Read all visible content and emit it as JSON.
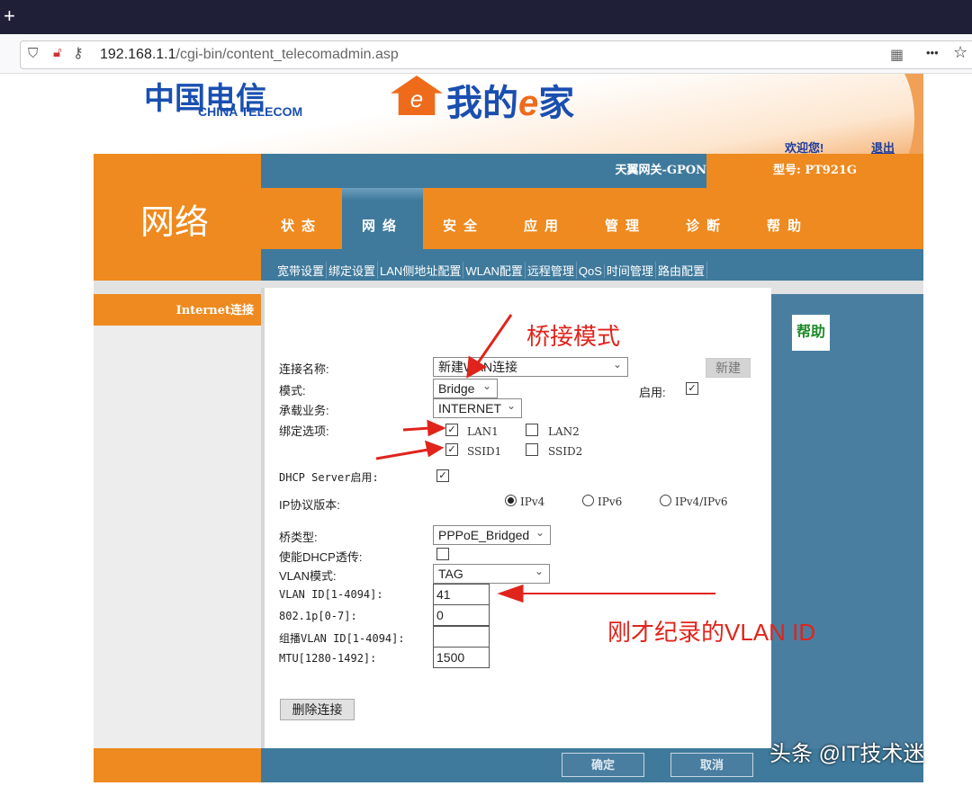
{
  "browser": {
    "new_tab": "+",
    "url_host": "192.168.1.1",
    "url_path": "/cgi-bin/content_telecomadmin.asp",
    "menu": "•••"
  },
  "header": {
    "logo_cn": "中国电信",
    "logo_en": "CHINA TELECOM",
    "brand_house": "e",
    "brand": "我的",
    "brand_e": "e",
    "brand_tail": "家",
    "welcome": "欢迎您!",
    "logout": "退出",
    "gateway": "天翼网关-GPON",
    "model": "型号: PT921G",
    "section": "网络"
  },
  "nav": [
    "状态",
    "网络",
    "安全",
    "应用",
    "管理",
    "诊断",
    "帮助"
  ],
  "subnav": [
    "宽带设置",
    "绑定设置",
    "LAN侧地址配置",
    "WLAN配置",
    "远程管理",
    "QoS",
    "时间管理",
    "路由配置"
  ],
  "sidebar": {
    "item": "Internet连接"
  },
  "help": "帮助",
  "form": {
    "conn_name_label": "连接名称:",
    "conn_name": "新建WAN连接",
    "new_button": "新建",
    "mode_label": "模式:",
    "mode": "Bridge",
    "enable_label": "启用:",
    "enable": true,
    "service_label": "承载业务:",
    "service": "INTERNET",
    "bind_label": "绑定选项:",
    "bind": [
      {
        "label": "LAN1",
        "checked": true
      },
      {
        "label": "LAN2",
        "checked": false
      },
      {
        "label": "SSID1",
        "checked": true
      },
      {
        "label": "SSID2",
        "checked": false
      }
    ],
    "dhcp_label": "DHCP Server启用:",
    "dhcp": true,
    "ip_label": "IP协议版本:",
    "ip_options": [
      "IPv4",
      "IPv6",
      "IPv4/IPv6"
    ],
    "ip_selected": "IPv4",
    "bridge_type_label": "桥类型:",
    "bridge_type": "PPPoE_Bridged",
    "dhcp_relay_label": "使能DHCP透传:",
    "dhcp_relay": false,
    "vlan_mode_label": "VLAN模式:",
    "vlan_mode": "TAG",
    "vlan_id_label": "VLAN ID[1-4094]:",
    "vlan_id": "41",
    "p8021_label": "802.1p[0-7]:",
    "p8021": "0",
    "mcast_label": "组播VLAN ID[1-4094]:",
    "mcast": "",
    "mtu_label": "MTU[1280-1492]:",
    "mtu": "1500",
    "delete_button": "删除连接"
  },
  "footer": {
    "ok": "确定",
    "cancel": "取消"
  },
  "annotations": {
    "bridge": "桥接模式",
    "vlan": "刚才纪录的VLAN ID",
    "color": "#e0241c"
  },
  "watermark": "头条 @IT技术迷",
  "colors": {
    "orange": "#ee8a1f",
    "blue": "#3f7a9c"
  }
}
